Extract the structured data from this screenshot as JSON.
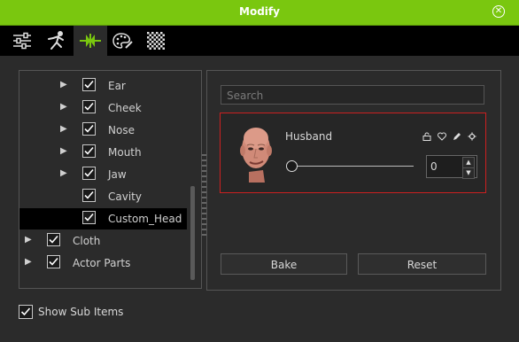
{
  "window": {
    "title": "Modify",
    "close_icon": "close-circle-icon"
  },
  "toolbar": {
    "tools": [
      {
        "icon": "sliders-icon",
        "active": false
      },
      {
        "icon": "motion-figure-icon",
        "active": false
      },
      {
        "icon": "morph-arrows-icon",
        "active": true
      },
      {
        "icon": "palette-icon",
        "active": false
      },
      {
        "icon": "checker-icon",
        "active": false
      }
    ]
  },
  "tree": {
    "items": [
      {
        "label": "Ear",
        "checked": true,
        "expandable": true
      },
      {
        "label": "Cheek",
        "checked": true,
        "expandable": true
      },
      {
        "label": "Nose",
        "checked": true,
        "expandable": true
      },
      {
        "label": "Mouth",
        "checked": true,
        "expandable": true
      },
      {
        "label": "Jaw",
        "checked": true,
        "expandable": true
      },
      {
        "label": "Cavity",
        "checked": true,
        "expandable": false
      },
      {
        "label": "Custom_Head",
        "checked": true,
        "expandable": false,
        "selected": true
      },
      {
        "label": "Cloth",
        "checked": true,
        "expandable": true
      },
      {
        "label": "Actor Parts",
        "checked": true,
        "expandable": true
      }
    ]
  },
  "search": {
    "placeholder": "Search"
  },
  "morph": {
    "name": "Husband",
    "value": "0",
    "slider_fraction": 0,
    "icons": [
      "unlock-icon",
      "heart-icon",
      "pencil-icon",
      "gear-icon"
    ]
  },
  "buttons": {
    "bake": "Bake",
    "reset": "Reset"
  },
  "footer": {
    "show_sub_items_label": "Show Sub Items",
    "show_sub_items_checked": true
  },
  "colors": {
    "accent": "#7ac70f",
    "highlight_border": "#cc2020"
  }
}
